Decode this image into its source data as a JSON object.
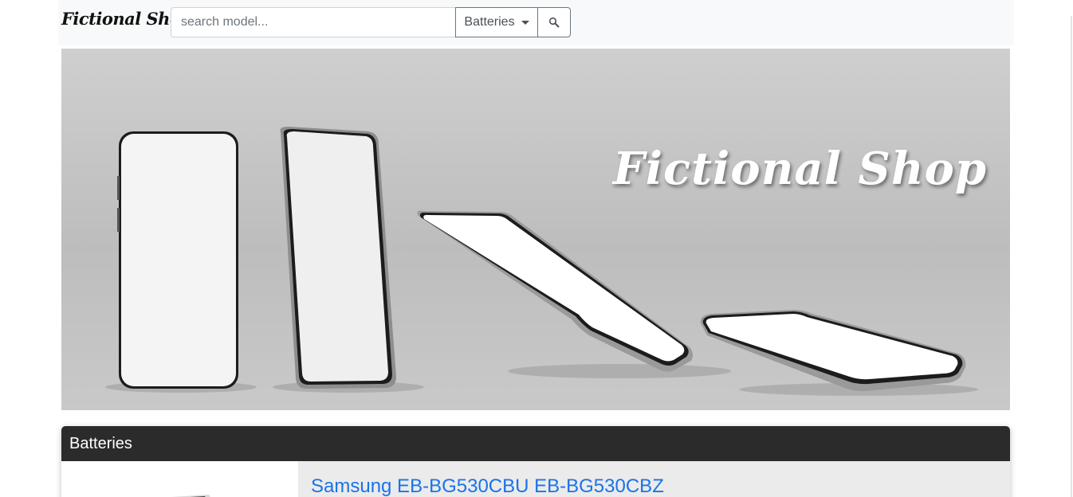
{
  "navbar": {
    "brand": "Fictional Shop",
    "search": {
      "placeholder": "search model...",
      "value": ""
    },
    "category_dropdown": {
      "label": "Batteries"
    },
    "search_button_icon": "search-icon"
  },
  "hero": {
    "title": "Fictional Shop",
    "image_description_icon": "phones-banner"
  },
  "section": {
    "title": "Batteries",
    "products": [
      {
        "name": "Samsung EB-BG530CBU EB-BG530CBZ",
        "thumb_icon": "battery-image"
      }
    ]
  },
  "colors": {
    "navbar_bg": "#f8f9fa",
    "section_header_bg": "#2b2b2b",
    "link": "#1a73e8",
    "product_info_bg": "#ebebeb"
  }
}
